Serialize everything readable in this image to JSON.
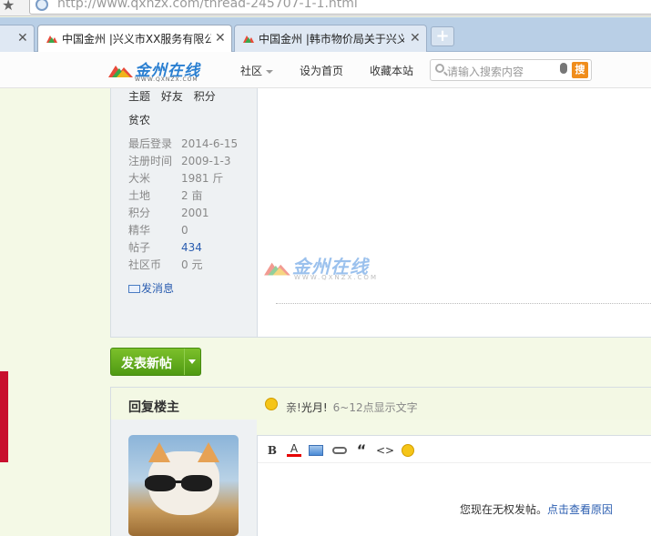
{
  "browser": {
    "url": "http://www.qxnzx.com/thread-245707-1-1.html",
    "tabs": [
      {
        "title": "中国金州 |兴义市XX服务有限公",
        "active": true
      },
      {
        "title": "中国金州 |韩市物价局关于兴义",
        "active": false
      }
    ],
    "new_tab_symbol": "+"
  },
  "site_nav": {
    "logo_text": "金州在线",
    "logo_domain": "WWW.QXNZX.COM",
    "links": [
      "社区",
      "设为首页",
      "收藏本站"
    ],
    "search_placeholder": "请输入搜索内容",
    "search_button": "搜"
  },
  "user_panel": {
    "tabs": [
      "主题",
      "好友",
      "积分"
    ],
    "rank": "贫农",
    "stats": [
      {
        "label": "最后登录",
        "value": "2014-6-15"
      },
      {
        "label": "注册时间",
        "value": "2009-1-3"
      },
      {
        "label": "大米",
        "value": "1981 斤"
      },
      {
        "label": "土地",
        "value": "2 亩"
      },
      {
        "label": "积分",
        "value": "2001"
      },
      {
        "label": "精华",
        "value": "0"
      },
      {
        "label": "帖子",
        "value": "434"
      },
      {
        "label": "社区币",
        "value": "0 元"
      }
    ],
    "send_message": "发消息"
  },
  "post": {
    "watermark_text": "金州在线",
    "watermark_domain": "WWW.QXNZX.COM"
  },
  "new_post_button": "发表新帖",
  "reply": {
    "title": "回复楼主",
    "greeting_prefix": "亲!",
    "greeting_name": "光月!",
    "greeting_hint": "6~12点显示文字",
    "toolbar": {
      "bold": "B",
      "color": "A",
      "quote": "“",
      "code": "<>"
    },
    "notice": "您现在无权发帖。",
    "notice_link": "点击查看原因"
  },
  "colors": {
    "accent_link": "#2a5db0",
    "new_post_green": "#5aa61a",
    "page_bg": "#f4f9e6"
  }
}
